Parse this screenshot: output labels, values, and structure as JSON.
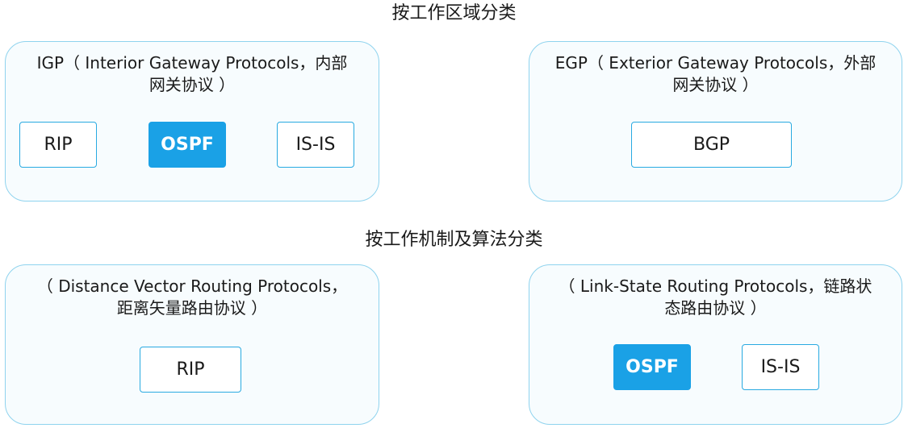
{
  "headings": {
    "by_area": "按工作区域分类",
    "by_mechanism": "按工作机制及算法分类"
  },
  "groups": {
    "igp": {
      "title_line1": "IGP（ Interior Gateway Protocols，内部",
      "title_line2": "网关协议 ）",
      "protocols": [
        "RIP",
        "OSPF",
        "IS-IS"
      ]
    },
    "egp": {
      "title_line1": "EGP（ Exterior Gateway Protocols，外部",
      "title_line2": "网关协议 ）",
      "protocols": [
        "BGP"
      ]
    },
    "dv": {
      "title_line1": "（ Distance Vector Routing Protocols，",
      "title_line2": "距离矢量路由协议 ）",
      "protocols": [
        "RIP"
      ]
    },
    "ls": {
      "title_line1": "（ Link-State Routing Protocols，链路状",
      "title_line2": "态路由协议 ）",
      "protocols": [
        "OSPF",
        "IS-IS"
      ]
    }
  },
  "colors": {
    "group_border": "#8fd3ee",
    "group_fill": "#f7fcfe",
    "protocol_border": "#29aae1",
    "highlight_fill": "#1aa1e6",
    "highlight_text": "#ffffff"
  },
  "highlighted_protocol": "OSPF"
}
